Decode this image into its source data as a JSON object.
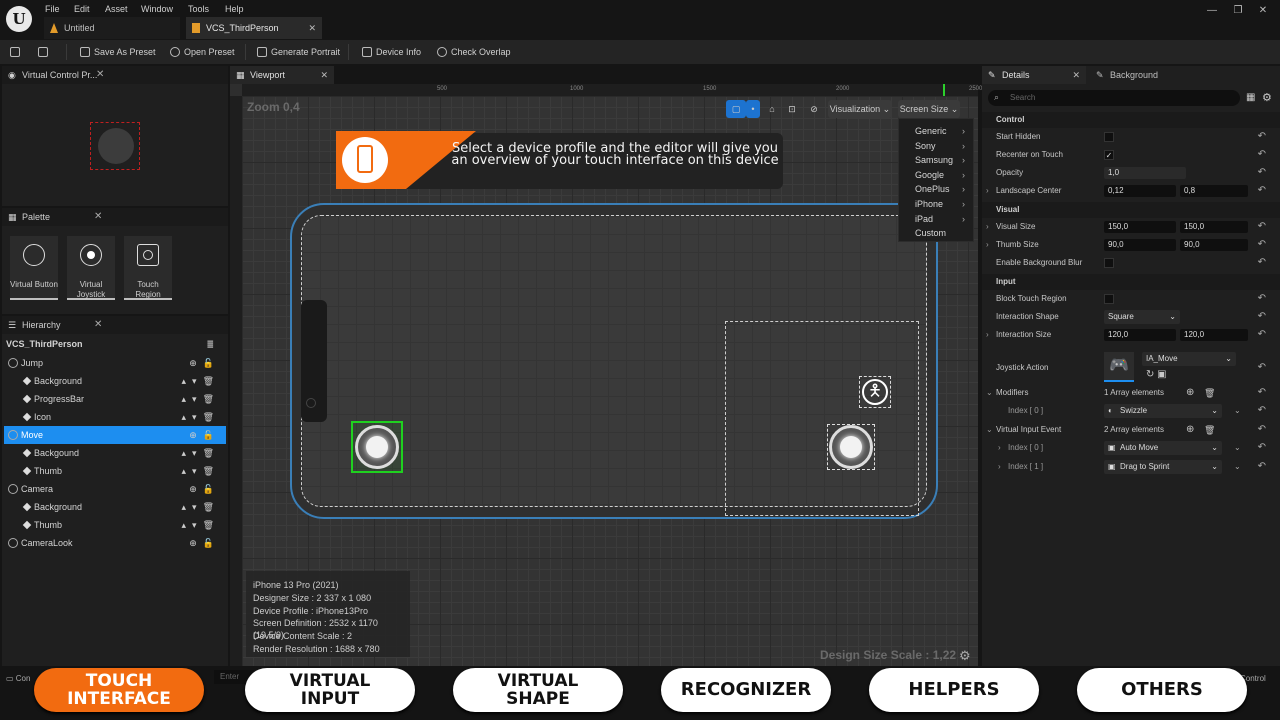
{
  "menu": [
    "File",
    "Edit",
    "Asset",
    "Window",
    "Tools",
    "Help"
  ],
  "tabs": [
    "Untitled",
    "VCS_ThirdPerson"
  ],
  "toolbar": {
    "save_preset": "Save As Preset",
    "open_preset": "Open Preset",
    "generate_portrait": "Generate Portrait",
    "device_info": "Device Info",
    "check_overlap": "Check Overlap"
  },
  "panels": {
    "preview": "Virtual Control Pr...",
    "palette": "Palette",
    "hierarchy": "Hierarchy",
    "viewport": "Viewport",
    "details": "Details",
    "background": "Background"
  },
  "palette": [
    {
      "label": "Virtual Button"
    },
    {
      "label": "Virtual Joystick"
    },
    {
      "label": "Touch Region"
    }
  ],
  "hierarchy": {
    "root": "VCS_ThirdPerson",
    "items": [
      {
        "label": "Jump",
        "level": 0
      },
      {
        "label": "Background",
        "level": 1
      },
      {
        "label": "ProgressBar",
        "level": 1
      },
      {
        "label": "Icon",
        "level": 1
      },
      {
        "label": "Move",
        "level": 0,
        "selected": true
      },
      {
        "label": "Backgound",
        "level": 1
      },
      {
        "label": "Thumb",
        "level": 1
      },
      {
        "label": "Camera",
        "level": 0
      },
      {
        "label": "Background",
        "level": 1
      },
      {
        "label": "Thumb",
        "level": 1
      },
      {
        "label": "CameraLook",
        "level": 0
      }
    ]
  },
  "viewport": {
    "zoom": "Zoom 0,4",
    "visualization": "Visualization",
    "screen_size": "Screen Size",
    "design_scale": "Design Size Scale : 1,22",
    "ruler": [
      "500",
      "1000",
      "1500",
      "2000",
      "2500"
    ],
    "banner": "Select a device profile and the editor will give you an overview of your touch interface on this device",
    "dropdown": [
      "Generic",
      "Sony",
      "Samsung",
      "Google",
      "OnePlus",
      "iPhone",
      "iPad",
      "Custom"
    ],
    "info": [
      "iPhone 13 Pro (2021)",
      "Designer Size : 2 337 x 1 080",
      "Device Profile : iPhone13Pro",
      "Screen Definition : 2532 x 1170 (19.5/9)",
      "Device Content Scale : 2",
      "Render Resolution : 1688 x 780"
    ]
  },
  "details": {
    "search_placeholder": "Search",
    "control": "Control",
    "start_hidden": "Start Hidden",
    "recenter": "Recenter on Touch",
    "opacity": "Opacity",
    "opacity_val": "1,0",
    "landscape": "Landscape Center",
    "landscape_x": "0,12",
    "landscape_y": "0,8",
    "visual": "Visual",
    "visual_size": "Visual Size",
    "visual_x": "150,0",
    "visual_y": "150,0",
    "thumb_size": "Thumb Size",
    "thumb_x": "90,0",
    "thumb_y": "90,0",
    "blur": "Enable Background Blur",
    "input": "Input",
    "block": "Block Touch Region",
    "shape": "Interaction Shape",
    "shape_val": "Square",
    "isize": "Interaction Size",
    "isize_x": "120,0",
    "isize_y": "120,0",
    "action": "Joystick Action",
    "action_val": "IA_Move",
    "modifiers": "Modifiers",
    "mod_count": "1 Array elements",
    "mod_index": "Index [ 0 ]",
    "mod_val": "Swizzle",
    "vie": "Virtual Input Event",
    "vie_count": "2 Array elements",
    "vie_i0": "Index [ 0 ]",
    "vie_v0": "Auto Move",
    "vie_i1": "Index [ 1 ]",
    "vie_v1": "Drag to Sprint"
  },
  "bottom": {
    "left": "Con",
    "enter": "Enter",
    "right": "Control"
  },
  "pills": [
    {
      "l1": "TOUCH",
      "l2": "INTERFACE"
    },
    {
      "l1": "VIRTUAL",
      "l2": "INPUT"
    },
    {
      "l1": "VIRTUAL",
      "l2": "SHAPE"
    },
    {
      "l1": "RECOGNIZER",
      "l2": ""
    },
    {
      "l1": "HELPERS",
      "l2": ""
    },
    {
      "l1": "OTHERS",
      "l2": ""
    }
  ],
  "colors": {
    "accent": "#f26b10",
    "selection": "#1d8ef0",
    "joystick_box": "#1fd11f"
  }
}
